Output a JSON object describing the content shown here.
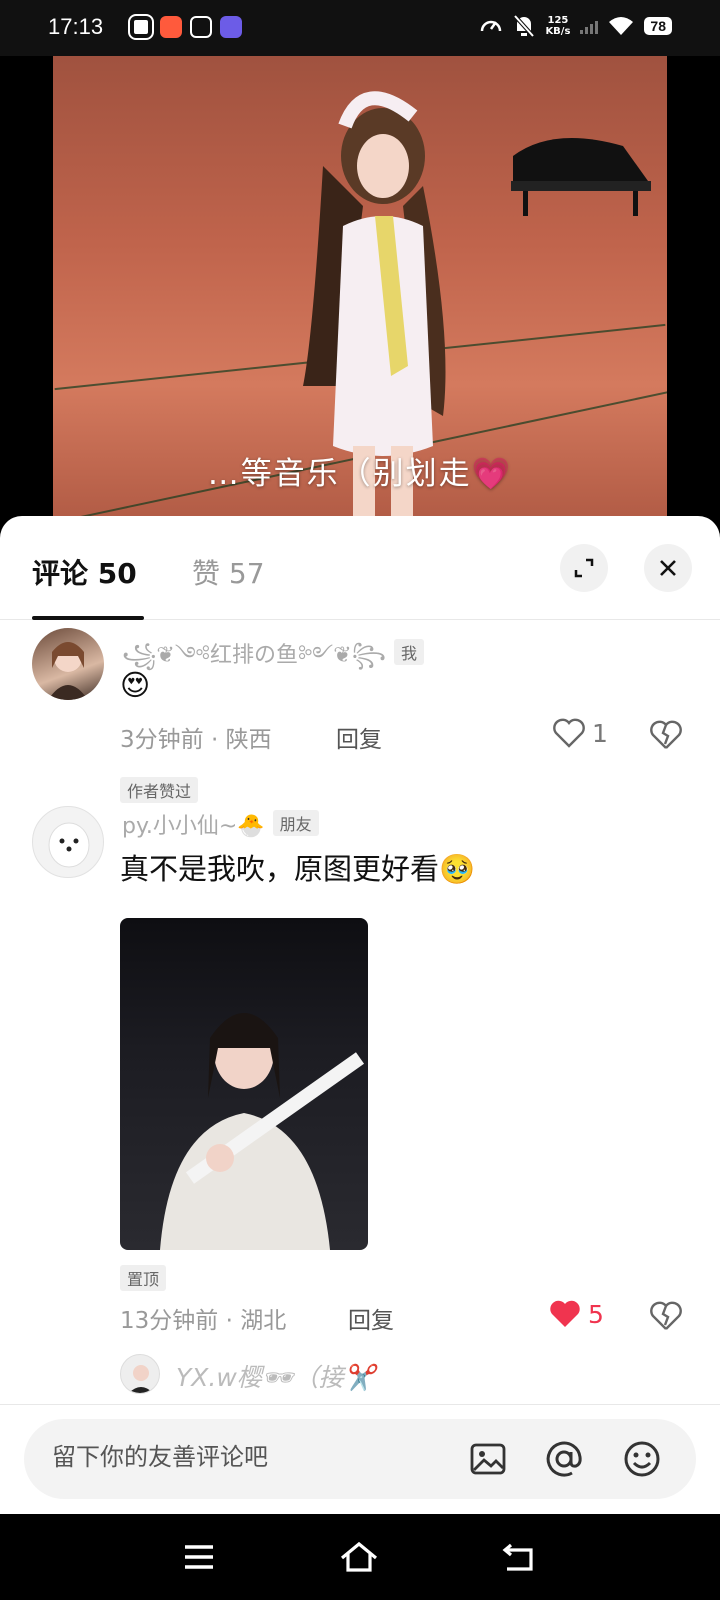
{
  "status_bar": {
    "time": "17:13",
    "net_speed_value": "125",
    "net_speed_unit": "KB/s",
    "battery": "78"
  },
  "video": {
    "subtitle": "…等音乐（别划走💗"
  },
  "comments_panel": {
    "tab_comments": "评论 50",
    "tab_likes": "赞 57",
    "comments": [
      {
        "username": "꧁❦༺红排の鱼༻❦꧂",
        "tag": "我",
        "text": "😍",
        "time_location": "3分钟前 · 陕西",
        "reply_label": "回复",
        "likes": "1",
        "liked": false,
        "badge": "作者赞过"
      },
      {
        "username": "py.小小仙~🐣",
        "tag": "朋友",
        "text": "真不是我吹，原图更好看🥹",
        "pinned_label": "置顶",
        "time_location": "13分钟前 · 湖北",
        "reply_label": "回复",
        "likes": "5",
        "liked": true
      },
      {
        "username": "YX.w樱🕶（接✂️"
      }
    ]
  },
  "input": {
    "placeholder": "留下你的友善评论吧"
  },
  "colors": {
    "accent_like": "#f0344f",
    "sheet_bg": "#ffffff",
    "status_bg": "#111111"
  }
}
